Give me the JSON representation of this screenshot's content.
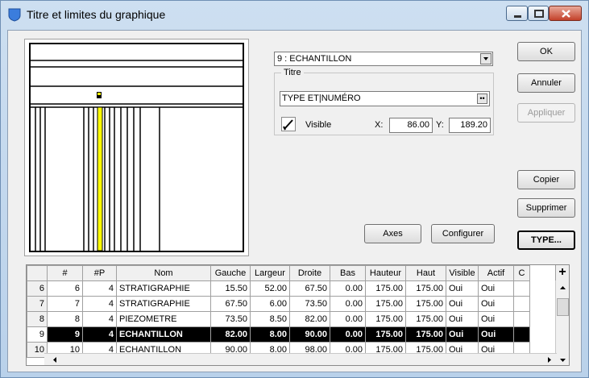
{
  "window": {
    "title": "Titre et limites du graphique"
  },
  "selector": {
    "value": "9 : ECHANTILLON"
  },
  "title_group": {
    "label": "Titre",
    "text_value": "TYPE ET|NUMÉRO",
    "visible_label": "Visible",
    "visible_checked": true,
    "x_label": "X:",
    "x_value": "86.00",
    "y_label": "Y:",
    "y_value": "189.20"
  },
  "buttons": {
    "ok": "OK",
    "cancel": "Annuler",
    "apply": "Appliquer",
    "copy": "Copier",
    "delete": "Supprimer",
    "type": "TYPE...",
    "axes": "Axes",
    "configure": "Configurer"
  },
  "table": {
    "columns": [
      "#",
      "#P",
      "Nom",
      "Gauche",
      "Largeur",
      "Droite",
      "Bas",
      "Hauteur",
      "Haut",
      "Visible",
      "Actif",
      "C"
    ],
    "rows": [
      {
        "row_header": "6",
        "cells": [
          "6",
          "4",
          "STRATIGRAPHIE",
          "15.50",
          "52.00",
          "67.50",
          "0.00",
          "175.00",
          "175.00",
          "Oui",
          "Oui",
          ""
        ]
      },
      {
        "row_header": "7",
        "cells": [
          "7",
          "4",
          "STRATIGRAPHIE",
          "67.50",
          "6.00",
          "73.50",
          "0.00",
          "175.00",
          "175.00",
          "Oui",
          "Oui",
          ""
        ]
      },
      {
        "row_header": "8",
        "cells": [
          "8",
          "4",
          "PIEZOMETRE",
          "73.50",
          "8.50",
          "82.00",
          "0.00",
          "175.00",
          "175.00",
          "Oui",
          "Oui",
          ""
        ]
      },
      {
        "row_header": "9",
        "cells": [
          "9",
          "4",
          "ECHANTILLON",
          "82.00",
          "8.00",
          "90.00",
          "0.00",
          "175.00",
          "175.00",
          "Oui",
          "Oui",
          ""
        ],
        "selected": true
      },
      {
        "row_header": "10",
        "cells": [
          "10",
          "4",
          "ECHANTILLON",
          "90.00",
          "8.00",
          "98.00",
          "0.00",
          "175.00",
          "175.00",
          "Oui",
          "Oui",
          ""
        ]
      }
    ]
  },
  "colors": {
    "selected_row_bg": "#000000",
    "preview_highlight": "#ffff00",
    "title_icon": "#3b7ddd"
  }
}
